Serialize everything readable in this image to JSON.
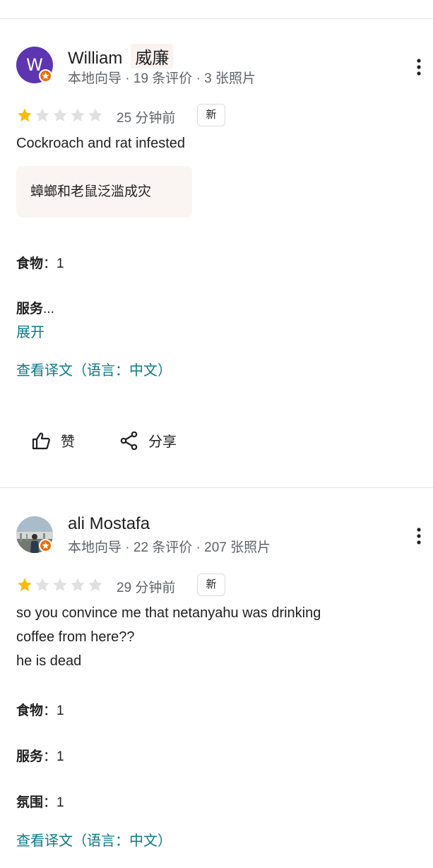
{
  "reviews": [
    {
      "author": {
        "name": "William",
        "name_translation": "威廉",
        "avatar_letter": "W",
        "avatar_color": "#5e35b1",
        "badge": "local-guide-star-icon",
        "meta": "本地向导 · 19 条评价 · 3 张照片"
      },
      "rating": 1,
      "max_rating": 5,
      "time": "25 分钟前",
      "new_badge": "新",
      "text": "Cockroach and rat infested",
      "translated_text": "蟑螂和老鼠泛滥成灾",
      "ratings": [
        {
          "label": "食物",
          "separator": "：",
          "value": "1"
        },
        {
          "label": "服务",
          "separator": "...",
          "value": ""
        }
      ],
      "expand_label": "展开",
      "translate_link": "查看译文（语言：中文）",
      "actions": {
        "like_label": "赞",
        "share_label": "分享"
      }
    },
    {
      "author": {
        "name": "ali Mostafa",
        "badge": "local-guide-star-icon",
        "meta": "本地向导 · 22 条评价 · 207 张照片"
      },
      "rating": 1,
      "max_rating": 5,
      "time": "29 分钟前",
      "new_badge": "新",
      "text_lines": [
        "so you convince me that netanyahu was drinking",
        "coffee from here??",
        "he is dead"
      ],
      "ratings": [
        {
          "label": "食物",
          "separator": "：",
          "value": "1"
        },
        {
          "label": "服务",
          "separator": "：",
          "value": "1"
        },
        {
          "label": "氛围",
          "separator": "：",
          "value": "1"
        }
      ],
      "translate_link": "查看译文（语言：中文）"
    }
  ],
  "colors": {
    "star_filled": "#fbbc04",
    "star_empty": "#e0e0e0",
    "link": "#0b7a85",
    "badge": "#e8710a"
  }
}
